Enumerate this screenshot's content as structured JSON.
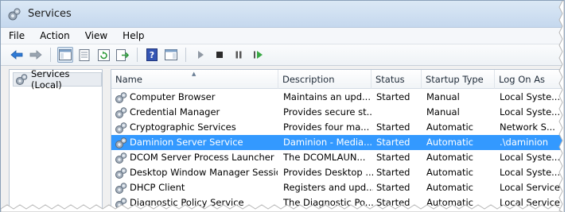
{
  "window": {
    "title": "Services"
  },
  "menu": [
    "File",
    "Action",
    "View",
    "Help"
  ],
  "tree": {
    "label": "Services (Local)"
  },
  "columns": [
    "Name",
    "Description",
    "Status",
    "Startup Type",
    "Log On As"
  ],
  "rows": [
    {
      "name": "Computer Browser",
      "description": "Maintains an upd...",
      "status": "Started",
      "startup": "Manual",
      "logon": "Local Syste..."
    },
    {
      "name": "Credential Manager",
      "description": "Provides secure st...",
      "status": "",
      "startup": "Manual",
      "logon": "Local Syste..."
    },
    {
      "name": "Cryptographic Services",
      "description": "Provides four ma...",
      "status": "Started",
      "startup": "Automatic",
      "logon": "Network S..."
    },
    {
      "name": "Daminion Server Service",
      "description": "Daminion - Media...",
      "status": "Started",
      "startup": "Automatic",
      "logon": ".\\daminion"
    },
    {
      "name": "DCOM Server Process Launcher",
      "description": "The DCOMLAUN...",
      "status": "Started",
      "startup": "Automatic",
      "logon": "Local Syste..."
    },
    {
      "name": "Desktop Window Manager Sessio...",
      "description": "Provides Desktop ...",
      "status": "Started",
      "startup": "Automatic",
      "logon": "Local Syste..."
    },
    {
      "name": "DHCP Client",
      "description": "Registers and upd...",
      "status": "Started",
      "startup": "Automatic",
      "logon": "Local Service"
    },
    {
      "name": "Diagnostic Policy Service",
      "description": "The Diagnostic Po...",
      "status": "Started",
      "startup": "Automatic",
      "logon": "Local Service"
    }
  ],
  "selected_row": 3,
  "colors": {
    "selection": "#3399ff",
    "title_gradient": "#c5d8ee"
  }
}
